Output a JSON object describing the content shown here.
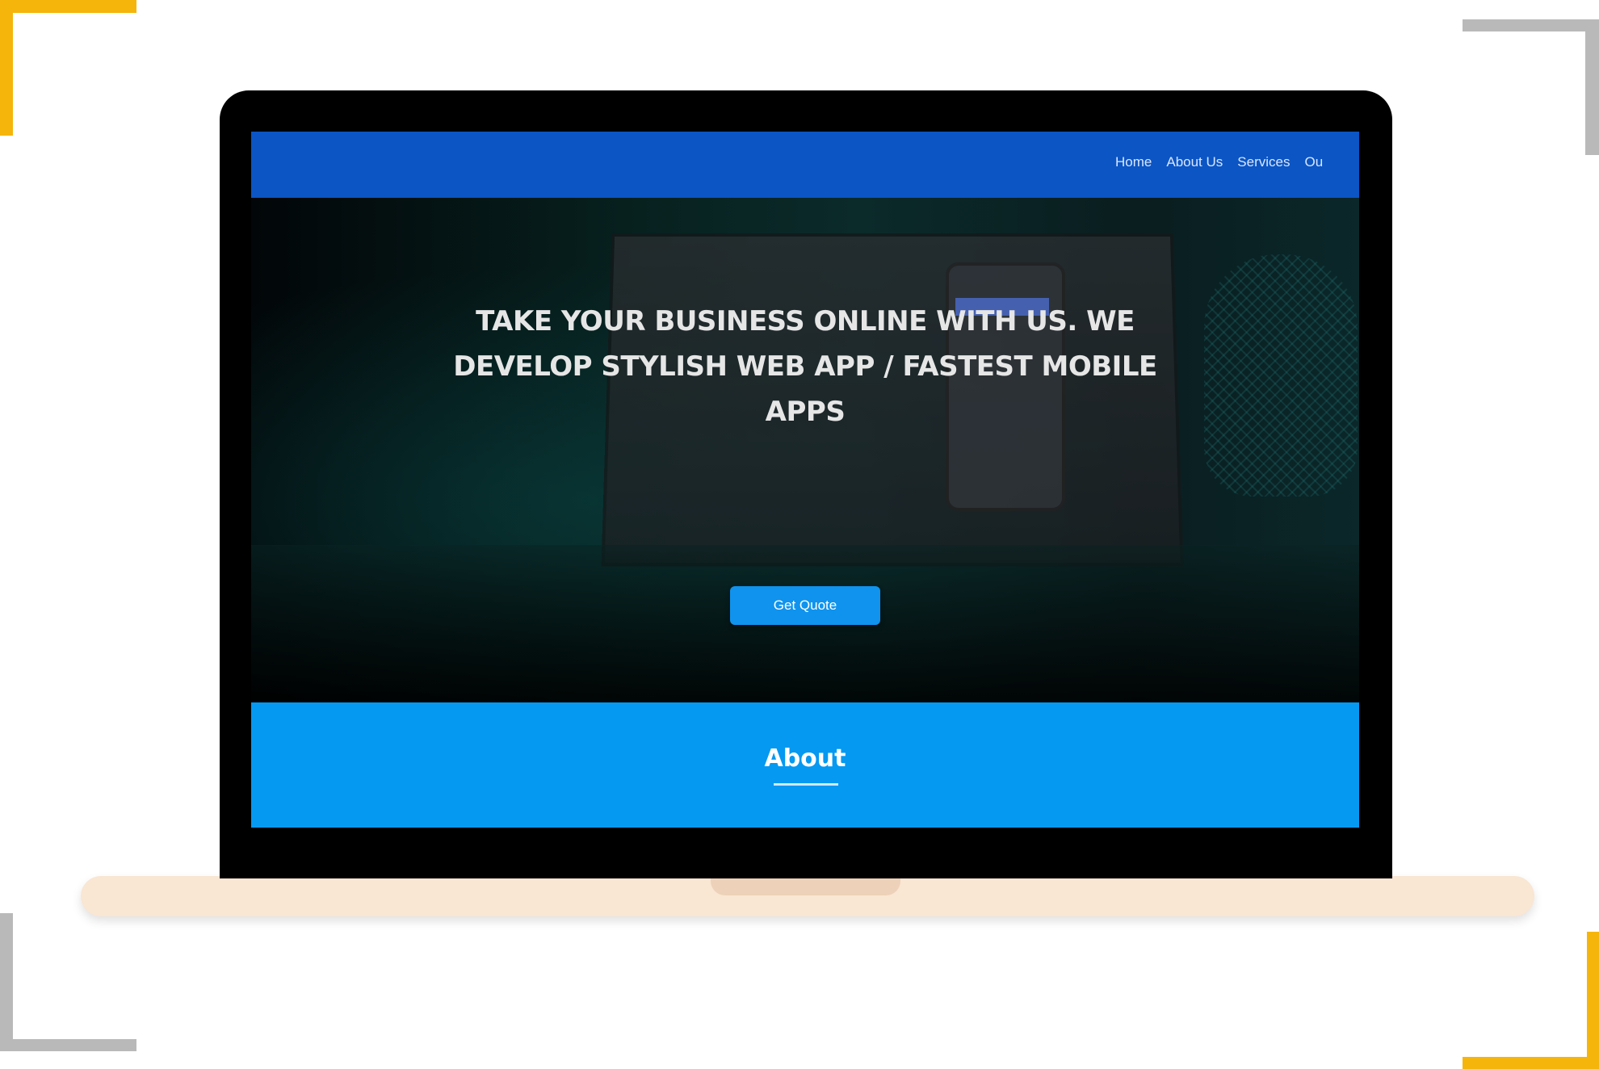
{
  "nav": {
    "links": [
      "Home",
      "About Us",
      "Services",
      "Ou"
    ]
  },
  "hero": {
    "headline": "TAKE YOUR BUSINESS ONLINE WITH US. WE DEVELOP STYLISH WEB APP / FASTEST MOBILE APPS",
    "cta_label": "Get Quote"
  },
  "about": {
    "heading": "About"
  },
  "colors": {
    "nav_bg": "#0b55c4",
    "about_bg": "#0599f1",
    "cta_bg": "#0f93ee",
    "corner_accent": "#f5b50b",
    "corner_gray": "#b9b9b9",
    "laptop_base": "#f9e6d3"
  }
}
